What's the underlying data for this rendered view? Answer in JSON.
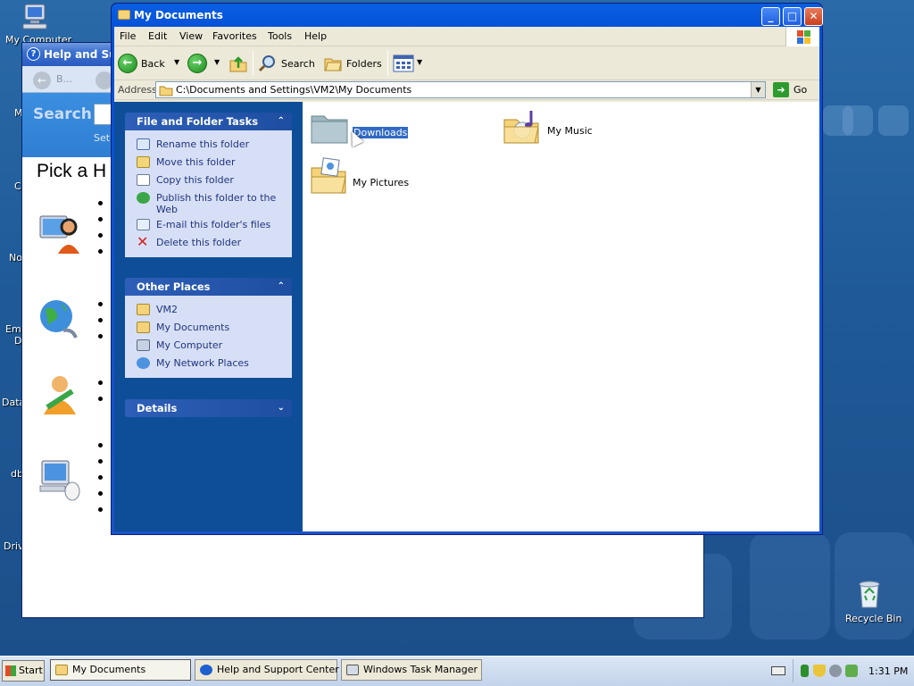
{
  "desktop": {
    "icons": {
      "my_computer": "My Computer",
      "recycle_bin": "Recycle Bin"
    },
    "partial_labels": [
      "M",
      "C",
      "No",
      "Em",
      "D",
      "Data",
      "db",
      "Driv"
    ]
  },
  "help_window": {
    "title": "Help and Supp",
    "back_label": "B...",
    "search_label": "Search",
    "set_text": "Set a",
    "heading": "Pick a H"
  },
  "explorer": {
    "title": "My Documents",
    "menu": [
      "File",
      "Edit",
      "View",
      "Favorites",
      "Tools",
      "Help"
    ],
    "toolbar": {
      "back": "Back",
      "search": "Search",
      "folders": "Folders"
    },
    "address": {
      "label": "Address",
      "value": "C:\\Documents and Settings\\VM2\\My Documents",
      "go": "Go"
    },
    "tasks_panel": {
      "title": "File and Folder Tasks",
      "items": [
        "Rename this folder",
        "Move this folder",
        "Copy this folder",
        "Publish this folder to the Web",
        "E-mail this folder's files",
        "Delete this folder"
      ]
    },
    "places_panel": {
      "title": "Other Places",
      "items": [
        "VM2",
        "My Documents",
        "My Computer",
        "My Network Places"
      ]
    },
    "details_panel": {
      "title": "Details"
    },
    "files": [
      {
        "name": "Downloads",
        "selected": true
      },
      {
        "name": "My Music",
        "selected": false
      },
      {
        "name": "My Pictures",
        "selected": false
      }
    ]
  },
  "taskbar": {
    "start": "Start",
    "buttons": [
      "My Documents",
      "Help and Support Center",
      "Windows Task Manager"
    ],
    "clock": "1:31 PM"
  },
  "colors": {
    "title_bar_blue": "#0550d6",
    "task_pane": "#0e4d98",
    "selection": "#316ac5",
    "folder_yellow": "#f5d37a"
  }
}
